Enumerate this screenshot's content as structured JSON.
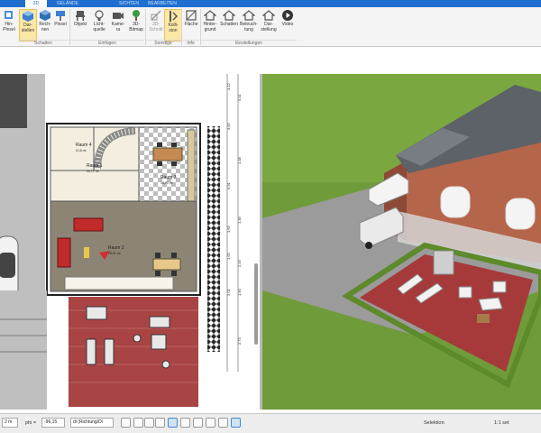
{
  "ribbon": {
    "tabs": [
      {
        "id": "t2d",
        "label": "",
        "active": false
      },
      {
        "id": "t3d",
        "label": "3D",
        "active": true
      },
      {
        "id": "tgelaende",
        "label": "GELÄNDE",
        "active": false
      },
      {
        "id": "tsichten",
        "label": "SICHTEN",
        "active": false
      },
      {
        "id": "tbearbeiten",
        "label": "BEARBEITEN",
        "active": false
      }
    ],
    "buttons": [
      {
        "id": "hint-pinsel",
        "label": "Hin- Pinsel",
        "icon": "paint-icon"
      },
      {
        "id": "darstellen",
        "label": "Dar- stellen",
        "icon": "cube-icon",
        "selected": true
      },
      {
        "id": "rechnen",
        "label": "Rech- nen",
        "icon": "cube-icon"
      },
      {
        "id": "pinsel",
        "label": "Pinsel",
        "icon": "brush-icon"
      },
      {
        "id": "objekt",
        "label": "Objekt",
        "icon": "chair-icon"
      },
      {
        "id": "lichtquelle",
        "label": "Licht- quelle",
        "icon": "bulb-icon"
      },
      {
        "id": "kamera",
        "label": "Kame- ra",
        "icon": "camera-icon"
      },
      {
        "id": "bitmap",
        "label": "3D- Bitmap",
        "icon": "tree-icon"
      },
      {
        "id": "schnitt",
        "label": "3D- Schnitt",
        "icon": "cut-icon"
      },
      {
        "id": "kollision",
        "label": "Kolli- sion",
        "icon": "collision-icon",
        "selected": true
      },
      {
        "id": "flaeche",
        "label": "Fläche",
        "icon": "area-icon"
      },
      {
        "id": "hintergrund",
        "label": "Hinter- grund",
        "icon": "house-icon"
      },
      {
        "id": "schatten",
        "label": "Schatten",
        "icon": "house-icon"
      },
      {
        "id": "beleuchtung",
        "label": "Beleuch- tung",
        "icon": "house-icon"
      },
      {
        "id": "darstellung",
        "label": "Dar- stellung",
        "icon": "house-icon"
      },
      {
        "id": "video",
        "label": "Video",
        "icon": "play-icon"
      }
    ],
    "groups": [
      {
        "id": "g-schatten",
        "label": "Schatten"
      },
      {
        "id": "g-einfuegen",
        "label": "Einfügen"
      },
      {
        "id": "g-sonstige",
        "label": "Sonstige"
      },
      {
        "id": "g-info",
        "label": "Info"
      },
      {
        "id": "g-einstellungen",
        "label": "Einstellungen"
      }
    ]
  },
  "plan": {
    "rooms": [
      {
        "id": "raum4",
        "label": "Raum 4",
        "sub": "5,16 m²"
      },
      {
        "id": "raum1",
        "label": "Raum 1",
        "sub": "20,77 m²"
      },
      {
        "id": "raum3",
        "label": "Raum 3",
        "sub": "14,70 m²"
      },
      {
        "id": "raum2",
        "label": "Raum 2",
        "sub": "28,91 m²"
      }
    ],
    "dimensions": [
      "4,12",
      "3,62",
      "6,91",
      "1,62",
      "1,62",
      "2,01",
      "3,41",
      "1,48",
      "1,49",
      "2,16",
      "1,90",
      "2,73"
    ]
  },
  "status": {
    "field1": "2 m",
    "phi_label": "phi =",
    "phi_value": "-96,15",
    "dl_value": "dl (Richtung/Di",
    "selection": "Selektion",
    "scale": "1:1 set"
  },
  "colors": {
    "ribbon_blue": "#1e6fd0",
    "terrace_red": "#a94444",
    "grass": "#6f9b3a"
  }
}
